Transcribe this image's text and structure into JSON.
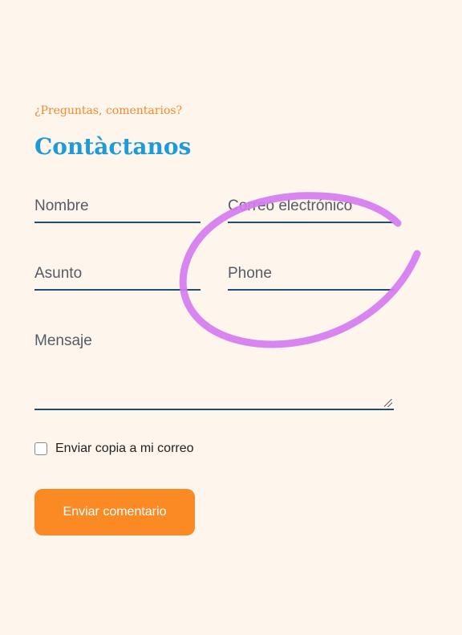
{
  "header": {
    "eyebrow": "¿Preguntas, comentarios?",
    "title": "Contàctanos"
  },
  "form": {
    "name_placeholder": "Nombre",
    "email_placeholder": "Correo electrónico",
    "subject_placeholder": "Asunto",
    "phone_placeholder": "Phone",
    "message_placeholder": "Mensaje",
    "send_copy_label": "Enviar copia a mi correo",
    "send_copy_checked": false,
    "submit_label": "Enviar comentario"
  },
  "annotation": {
    "shape": "hand-drawn ellipse",
    "color": "#d57bf0"
  },
  "colors": {
    "background": "#fef5ec",
    "accent_orange": "#fb8a25",
    "accent_blue": "#1d9ad9",
    "underline": "#1f4e73"
  }
}
